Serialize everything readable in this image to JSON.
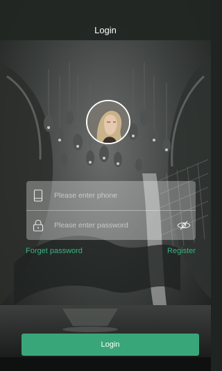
{
  "header": {
    "title": "Login"
  },
  "form": {
    "phone_placeholder": "Please enter phone",
    "phone_value": "",
    "password_placeholder": "Please enter password",
    "password_value": ""
  },
  "links": {
    "forget_password": "Forget password",
    "register": "Register"
  },
  "actions": {
    "login_label": "Login"
  },
  "colors": {
    "accent": "#39a67a",
    "link": "#3bb383",
    "titlebar": "#212623"
  },
  "icons": {
    "phone": "phone-icon",
    "lock": "lock-icon",
    "visibility": "eye-off-icon"
  }
}
